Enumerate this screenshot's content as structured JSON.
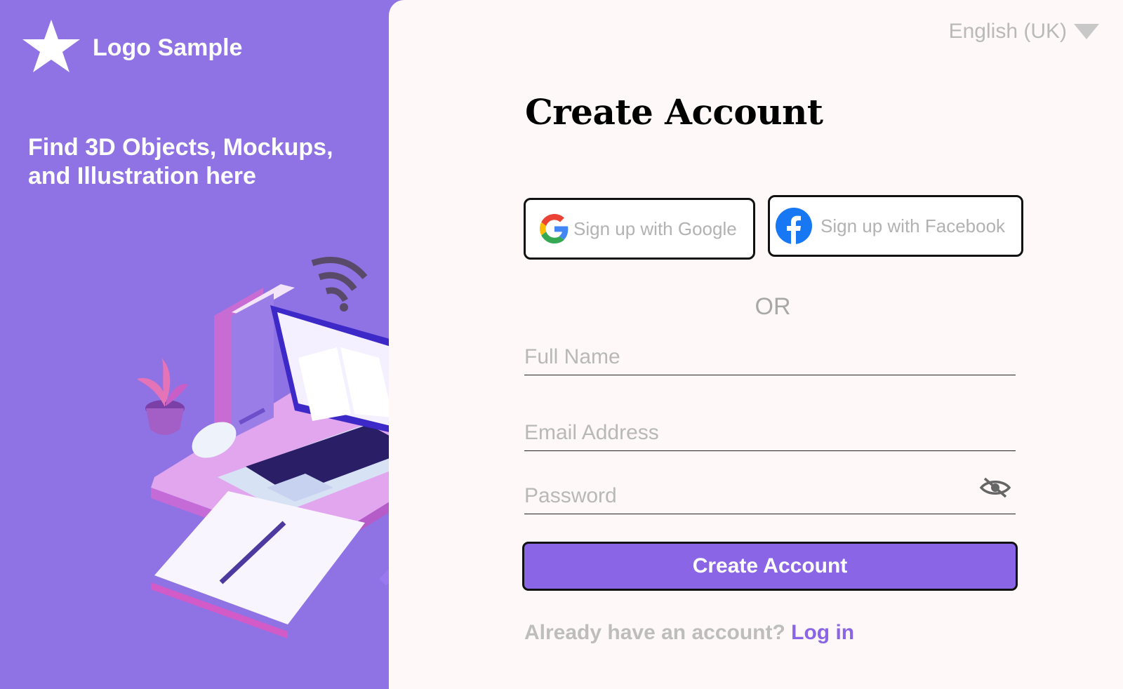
{
  "brand": {
    "logo_text": "Logo Sample",
    "tagline": "Find 3D Objects, Mockups, and Illustration here",
    "panel_color": "#8F72E3"
  },
  "language": {
    "selected": "English (UK)"
  },
  "form": {
    "title": "Create Account",
    "google_label": "Sign up with Google",
    "facebook_label": "Sign up with Facebook",
    "divider": "OR",
    "full_name_placeholder": "Full Name",
    "email_placeholder": "Email Address",
    "password_placeholder": "Password",
    "submit_label": "Create Account",
    "login_prompt": "Already have an account?",
    "login_link": "Log in",
    "accent_color": "#8A65E6"
  },
  "icons": {
    "logo": "star-icon",
    "language": "chevron-down-icon",
    "google": "google-icon",
    "facebook": "facebook-icon",
    "password_toggle": "eye-off-icon"
  }
}
